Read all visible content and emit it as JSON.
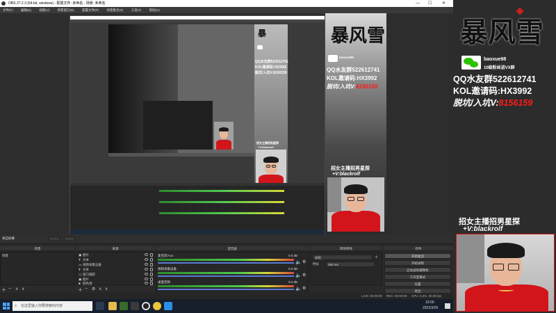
{
  "window": {
    "title": "OBS 27.2.3 (64-bit, windows) - 配置文件: 未命名 - 场景: 未命名",
    "minimize": "—",
    "maximize": "☐",
    "close": "✕"
  },
  "menu": [
    "文件(F)",
    "编辑(E)",
    "视图(V)",
    "停靠窗口(D)",
    "配置文件(P)",
    "场景集合(S)",
    "工具(T)",
    "帮助(H)"
  ],
  "promo": {
    "logo": "暴风雪",
    "wechat_id": "baoxue98",
    "wechat_note": "10级粉丝进VX群",
    "qq_group": "QQ水友群522612741",
    "kol_code": "KOL邀请码:HX3992",
    "quit_prefix": "脱坑/入坑V:",
    "quit_value": "8156159",
    "recruit_line1": "招女主播招男星探",
    "recruit_line2": "+V:blackrolf"
  },
  "nested_promo": {
    "qq": "QQ水友群522612741",
    "kol": "KOL邀请码:HX3992",
    "quit": "脱坑/入坑V:8156159",
    "recruit1": "招女主播招男星探",
    "recruit2": "+V:blackrolf"
  },
  "dock": {
    "scene_label": "来自屏幕",
    "headers": {
      "scenes": "场景",
      "sources": "来源",
      "mixer": "混音器",
      "transitions": "转场特效",
      "controls": "控件"
    },
    "scenes": [
      "场景"
    ],
    "sources": [
      "图片",
      "文本",
      "视频采集设备",
      "文本",
      "窗口捕获",
      "图片",
      "颜色源"
    ],
    "mixer": [
      {
        "name": "麦克风/Aux",
        "db": "0.0 dB"
      },
      {
        "name": "视频采集设备",
        "db": "0.0 dB"
      },
      {
        "name": "桌面音频",
        "db": "0.0 dB"
      }
    ],
    "transition": {
      "type": "淡化",
      "duration_label": "时长",
      "duration": "300 ms"
    },
    "controls": [
      "开始推流",
      "开始录制",
      "启动虚拟摄像机",
      "工作室模式",
      "设置",
      "退出"
    ]
  },
  "status": {
    "live": "LIVE: 00:00:00",
    "rec": "REC: 00:00:00",
    "cpu": "CPU: 3.3%, 60.00 fps"
  },
  "taskbar": {
    "search_placeholder": "在这里输入你要搜索的内容",
    "time": "19:00",
    "date": "2022/3/26"
  },
  "colors": {
    "accent": "#ff1a1a",
    "shirt": "#d2151b",
    "meter_green": "#4fc94f",
    "taskbar": "#161f2b"
  }
}
